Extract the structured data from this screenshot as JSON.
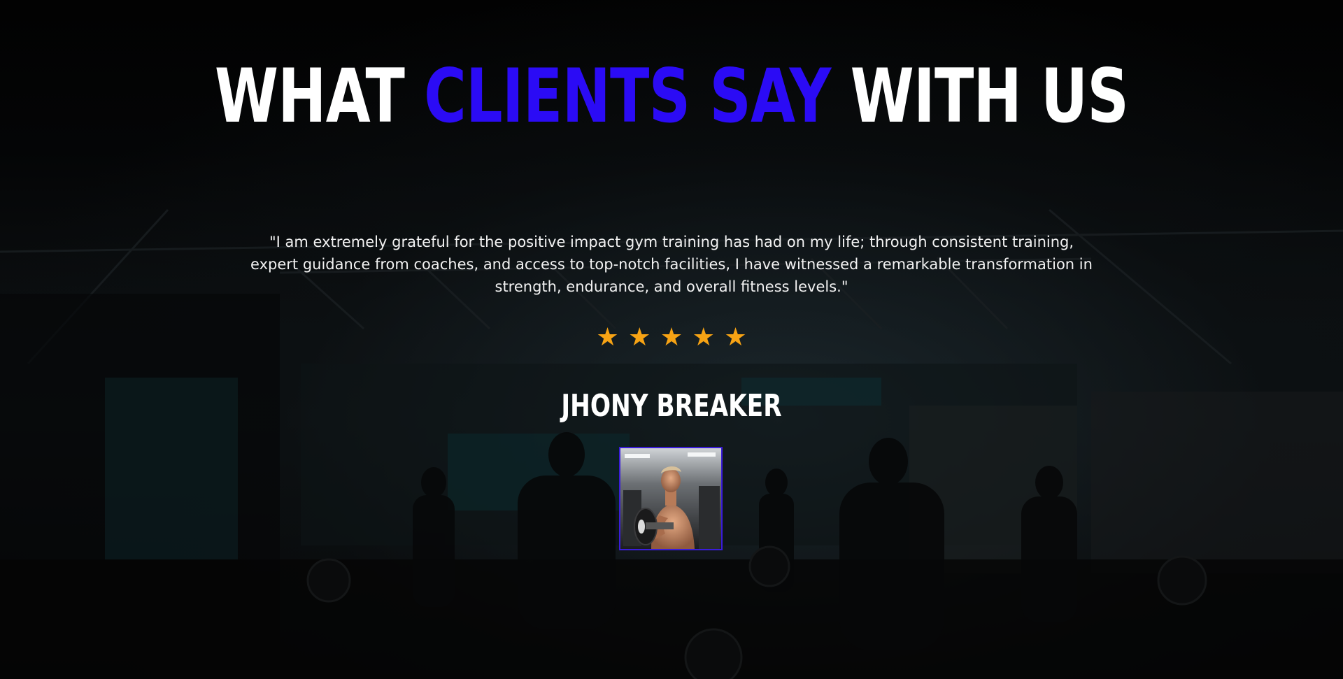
{
  "testimonials": {
    "heading_part1": "WHAT",
    "heading_accent": "CLIENTS SAY",
    "heading_part3": "WITH US",
    "quote": "\"I am extremely grateful for the positive impact gym training has had on my life; through consistent training, expert guidance from coaches, and access to top-notch facilities, I have witnessed a remarkable transformation in strength, endurance, and overall fitness levels.\"",
    "rating": 5,
    "rating_max": 5,
    "star_glyph": "★",
    "client_name": "JHONY BREAKER",
    "avatar_icon": "bodybuilder-photo",
    "background_image": "gym-interior-photo"
  },
  "colors": {
    "accent": "#2b0bf5",
    "star": "#f7a314",
    "text": "#ffffff",
    "background": "#000000"
  }
}
